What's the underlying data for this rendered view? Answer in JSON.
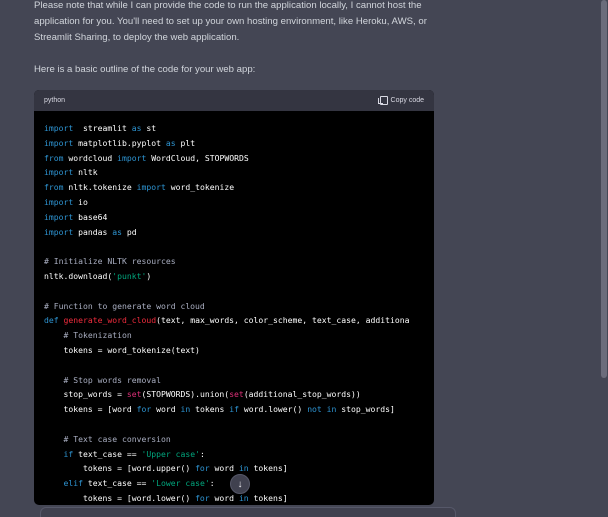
{
  "message": {
    "p1": "Please note that while I can provide the code to run the application locally, I cannot host the application for you. You'll need to set up your own hosting environment, like Heroku, AWS, or Streamlit Sharing, to deploy the web application.",
    "p2": "Here is a basic outline of the code for your web app:"
  },
  "code": {
    "language": "python",
    "copy_label": "Copy code"
  },
  "icons": {
    "copy": "copy-icon",
    "scroll_down": "arrow-down-icon"
  },
  "colors": {
    "background": "#444654",
    "code_background": "#000000",
    "code_header": "#343541",
    "keyword": "#2e95d3",
    "function": "#f22c3d",
    "string": "#00a67d",
    "comment": "#a9aec1",
    "builtin": "#df3079"
  },
  "code_lines": [
    [
      [
        "kw",
        "import"
      ],
      [
        "",
        "  streamlit "
      ],
      [
        "kw",
        "as"
      ],
      [
        "",
        " st"
      ]
    ],
    [
      [
        "kw",
        "import"
      ],
      [
        "",
        "",
        " matplotlib.pyplot "
      ],
      [
        "kw",
        "as"
      ],
      [
        "",
        " plt"
      ]
    ],
    [
      [
        "kw",
        "from"
      ],
      [
        "",
        " wordcloud "
      ],
      [
        "kw",
        "import"
      ],
      [
        "",
        " WordCloud, STOPWORDS"
      ]
    ],
    [
      [
        "kw",
        "import"
      ],
      [
        "",
        " nltk"
      ]
    ],
    [
      [
        "kw",
        "from"
      ],
      [
        "",
        " nltk.tokenize "
      ],
      [
        "kw",
        "import"
      ],
      [
        "",
        " word_tokenize"
      ]
    ],
    [
      [
        "kw",
        "import"
      ],
      [
        "",
        " io"
      ]
    ],
    [
      [
        "kw",
        "import"
      ],
      [
        "",
        " base64"
      ]
    ],
    [
      [
        "kw",
        "import"
      ],
      [
        "",
        " pandas "
      ],
      [
        "kw",
        "as"
      ],
      [
        "",
        " pd"
      ]
    ],
    [],
    [
      [
        "cm",
        "# Initialize NLTK resources"
      ]
    ],
    [
      [
        "",
        "nltk.download("
      ],
      [
        "st",
        "'punkt'"
      ],
      [
        "",
        ")"
      ]
    ],
    [],
    [
      [
        "cm",
        "# Function to generate word cloud"
      ]
    ],
    [
      [
        "kw",
        "def"
      ],
      [
        "",
        " "
      ],
      [
        "fn",
        "generate_word_cloud"
      ],
      [
        "",
        "(text, max_words, color_scheme, text_case, additiona"
      ]
    ],
    [
      [
        "",
        "    "
      ],
      [
        "cm",
        "# Tokenization"
      ]
    ],
    [
      [
        "",
        "    tokens = word_tokenize(text)"
      ]
    ],
    [],
    [
      [
        "",
        "    "
      ],
      [
        "cm",
        "# Stop words removal"
      ]
    ],
    [
      [
        "",
        "    stop_words = "
      ],
      [
        "bi",
        "set"
      ],
      [
        "",
        "(STOPWORDS).union("
      ],
      [
        "bi",
        "set"
      ],
      [
        "",
        "(additional_stop_words))"
      ]
    ],
    [
      [
        "",
        "    tokens = [word "
      ],
      [
        "kw",
        "for"
      ],
      [
        "",
        " word "
      ],
      [
        "kw",
        "in"
      ],
      [
        "",
        " tokens "
      ],
      [
        "kw",
        "if"
      ],
      [
        "",
        " word.lower() "
      ],
      [
        "kw",
        "not in"
      ],
      [
        "",
        " stop_words]"
      ]
    ],
    [],
    [
      [
        "",
        "    "
      ],
      [
        "cm",
        "# Text case conversion"
      ]
    ],
    [
      [
        "",
        "    "
      ],
      [
        "kw",
        "if"
      ],
      [
        "",
        " text_case == "
      ],
      [
        "st",
        "'Upper case'"
      ],
      [
        "",
        ":"
      ]
    ],
    [
      [
        "",
        "        tokens = [word.upper() "
      ],
      [
        "kw",
        "for"
      ],
      [
        "",
        " word "
      ],
      [
        "kw",
        "in"
      ],
      [
        "",
        " tokens]"
      ]
    ],
    [
      [
        "",
        "    "
      ],
      [
        "kw",
        "elif"
      ],
      [
        "",
        " text_case == "
      ],
      [
        "st",
        "'Lower case'"
      ],
      [
        "",
        ":"
      ]
    ],
    [
      [
        "",
        "        tokens = [word.lower() "
      ],
      [
        "kw",
        "for"
      ],
      [
        "",
        " word "
      ],
      [
        "kw",
        "in"
      ],
      [
        "",
        " tokens]"
      ]
    ]
  ]
}
